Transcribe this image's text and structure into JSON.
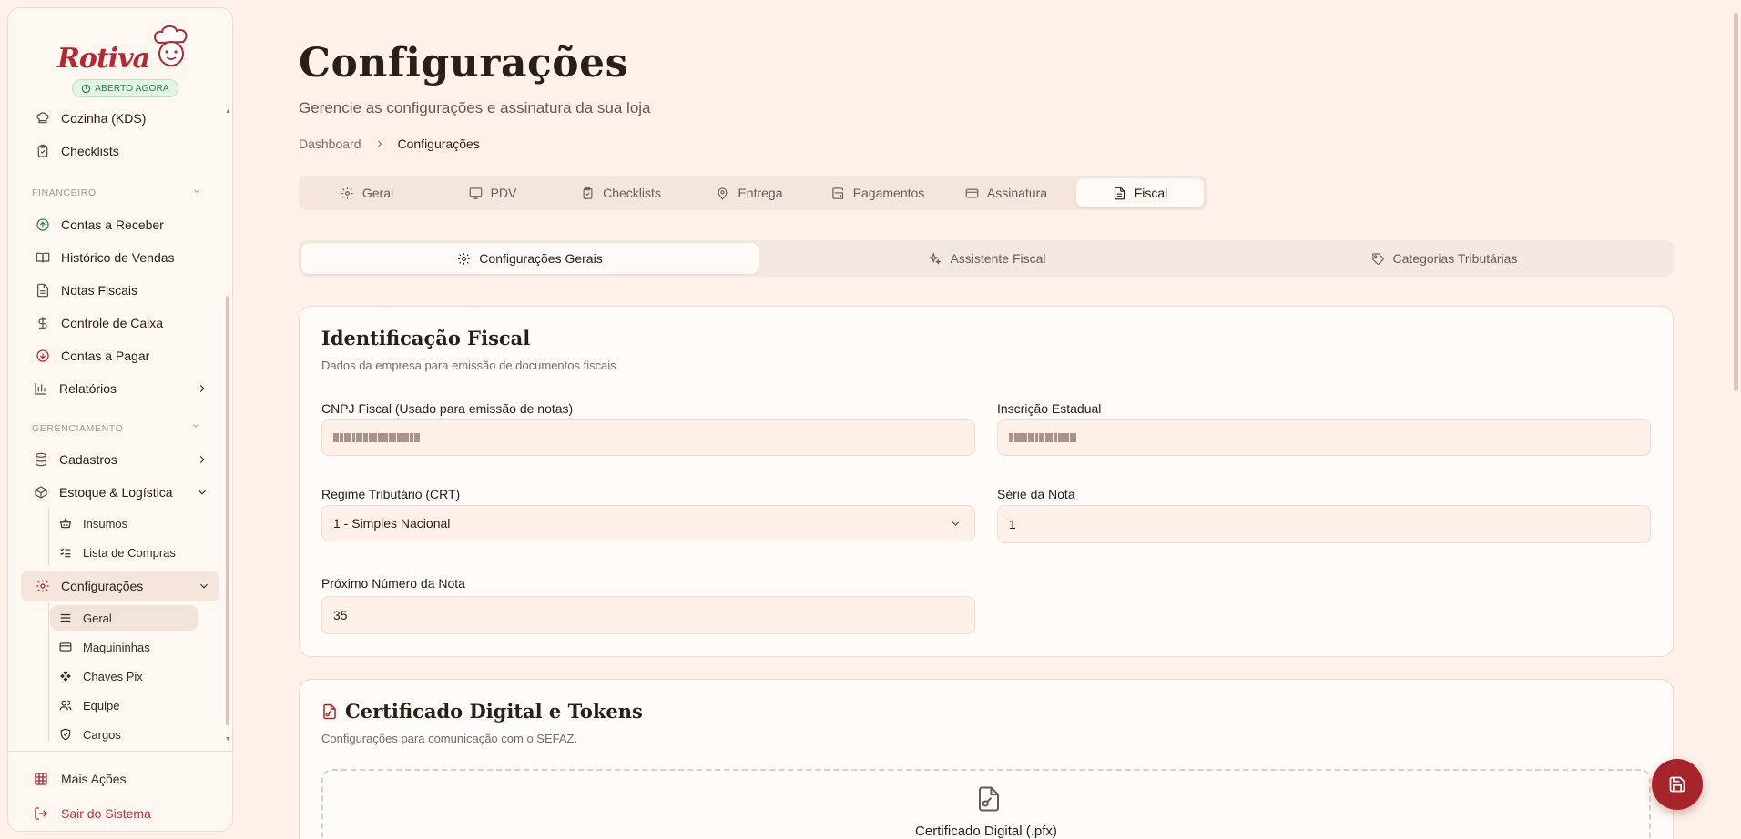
{
  "sidebar": {
    "logo_text": "Rotiva",
    "status_badge": "ABERTO AGORA",
    "items_top": [
      {
        "label": "Cozinha (KDS)",
        "icon": "chef-hat-icon"
      },
      {
        "label": "Checklists",
        "icon": "clipboard-check-icon"
      }
    ],
    "section_financeiro": "FINANCEIRO",
    "financeiro": [
      {
        "label": "Contas a Receber",
        "icon": "arrow-up-circle-icon"
      },
      {
        "label": "Histórico de Vendas",
        "icon": "book-open-icon"
      },
      {
        "label": "Notas Fiscais",
        "icon": "file-text-icon"
      },
      {
        "label": "Controle de Caixa",
        "icon": "dollar-sign-icon"
      },
      {
        "label": "Contas a Pagar",
        "icon": "arrow-down-circle-icon"
      },
      {
        "label": "Relatórios",
        "icon": "bar-chart-icon"
      }
    ],
    "section_gerenciamento": "GERENCIAMENTO",
    "gerenciamento": [
      {
        "label": "Cadastros",
        "icon": "database-icon"
      },
      {
        "label": "Estoque & Logística",
        "icon": "package-icon"
      }
    ],
    "estoque_sub": [
      {
        "label": "Insumos",
        "icon": "basket-icon"
      },
      {
        "label": "Lista de Compras",
        "icon": "list-checks-icon"
      }
    ],
    "configuracoes": {
      "label": "Configurações",
      "icon": "gear-icon"
    },
    "config_sub": [
      {
        "label": "Geral",
        "icon": "menu-icon"
      },
      {
        "label": "Maquininhas",
        "icon": "credit-card-icon"
      },
      {
        "label": "Chaves Pix",
        "icon": "pix-icon"
      },
      {
        "label": "Equipe",
        "icon": "users-icon"
      },
      {
        "label": "Cargos",
        "icon": "shield-icon"
      }
    ],
    "footer": {
      "more_actions": "Mais Ações",
      "logout": "Sair do Sistema"
    }
  },
  "header": {
    "title": "Configurações",
    "subtitle": "Gerencie as configurações e assinatura da sua loja",
    "breadcrumb": [
      "Dashboard",
      "Configurações"
    ]
  },
  "tabs": [
    {
      "label": "Geral",
      "icon": "gear-icon"
    },
    {
      "label": "PDV",
      "icon": "monitor-icon"
    },
    {
      "label": "Checklists",
      "icon": "clipboard-icon"
    },
    {
      "label": "Entrega",
      "icon": "map-pin-icon"
    },
    {
      "label": "Pagamentos",
      "icon": "wallet-icon"
    },
    {
      "label": "Assinatura",
      "icon": "credit-card-icon"
    },
    {
      "label": "Fiscal",
      "icon": "file-text-icon",
      "active": true
    }
  ],
  "subtabs": [
    {
      "label": "Configurações Gerais",
      "icon": "gear-icon",
      "active": true
    },
    {
      "label": "Assistente Fiscal",
      "icon": "sparkles-icon"
    },
    {
      "label": "Categorias Tributárias",
      "icon": "tag-icon"
    }
  ],
  "identificacao": {
    "title": "Identificação Fiscal",
    "description": "Dados da empresa para emissão de documentos fiscais.",
    "cnpj_label": "CNPJ Fiscal (Usado para emissão de notas)",
    "ie_label": "Inscrição Estadual",
    "regime_label": "Regime Tributário (CRT)",
    "regime_value": "1 - Simples Nacional",
    "serie_label": "Série da Nota",
    "serie_value": "1",
    "proximo_label": "Próximo Número da Nota",
    "proximo_value": "35"
  },
  "certificado": {
    "title": "Certificado Digital e Tokens",
    "description": "Configurações para comunicação com o SEFAZ.",
    "upload_label": "Certificado Digital (.pfx)"
  },
  "colors": {
    "accent": "#a8242b",
    "background": "#fdf1ea",
    "badge_green": "#2f7d45"
  }
}
